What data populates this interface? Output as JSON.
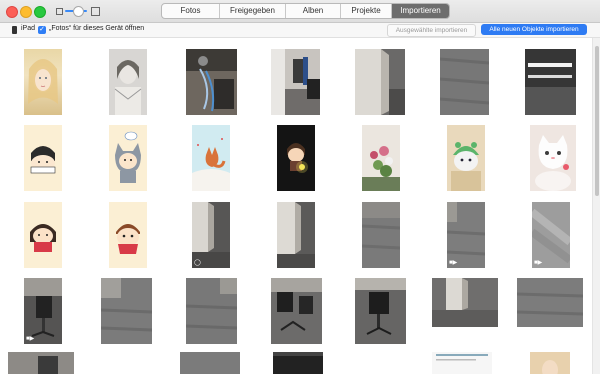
{
  "window": {
    "tabs": [
      {
        "label": "Fotos",
        "active": false
      },
      {
        "label": "Freigegeben",
        "active": false
      },
      {
        "label": "Alben",
        "active": false
      },
      {
        "label": "Projekte",
        "active": false
      },
      {
        "label": "Importieren",
        "active": true
      }
    ]
  },
  "toolbar": {
    "device_name": "iPad",
    "open_photos_checked": true,
    "open_photos_label": "„Fotos“ für dieses Gerät öffnen",
    "import_selected_label": "Ausgewählte importieren",
    "import_all_label": "Alle neuen Objekte importieren"
  },
  "colors": {
    "accent": "#2e7bf3",
    "active_tab": "#6d6d6d"
  },
  "thumbnails": [
    {
      "row": 1,
      "col": 1,
      "kind": "portrait girl blonde",
      "video": false
    },
    {
      "row": 1,
      "col": 2,
      "kind": "vintage portrait",
      "video": false
    },
    {
      "row": 1,
      "col": 3,
      "kind": "office cables",
      "video": false
    },
    {
      "row": 1,
      "col": 4,
      "kind": "office room",
      "video": false
    },
    {
      "row": 1,
      "col": 5,
      "kind": "office corner",
      "video": false
    },
    {
      "row": 1,
      "col": 6,
      "kind": "carpet floor",
      "video": false
    },
    {
      "row": 1,
      "col": 7,
      "kind": "ceiling lights",
      "video": false
    },
    {
      "row": 2,
      "col": 1,
      "kind": "cartoon character",
      "video": false
    },
    {
      "row": 2,
      "col": 2,
      "kind": "cartoon cat hood",
      "video": false
    },
    {
      "row": 2,
      "col": 3,
      "kind": "cartoon fox",
      "video": false
    },
    {
      "row": 2,
      "col": 4,
      "kind": "cartoon boy night",
      "video": false
    },
    {
      "row": 2,
      "col": 5,
      "kind": "flowers",
      "video": false
    },
    {
      "row": 2,
      "col": 6,
      "kind": "green hat kitten",
      "video": false
    },
    {
      "row": 2,
      "col": 7,
      "kind": "white kitten",
      "video": false
    },
    {
      "row": 3,
      "col": 1,
      "kind": "cartoon girl",
      "video": false
    },
    {
      "row": 3,
      "col": 2,
      "kind": "cartoon boy",
      "video": false
    },
    {
      "row": 3,
      "col": 3,
      "kind": "office wall",
      "video": true
    },
    {
      "row": 3,
      "col": 4,
      "kind": "office wall",
      "video": false
    },
    {
      "row": 3,
      "col": 5,
      "kind": "carpet",
      "video": false
    },
    {
      "row": 3,
      "col": 6,
      "kind": "carpet",
      "video": true
    },
    {
      "row": 3,
      "col": 7,
      "kind": "carpet blur",
      "video": true
    },
    {
      "row": 4,
      "col": 1,
      "kind": "office chair",
      "video": true
    },
    {
      "row": 4,
      "col": 2,
      "kind": "carpet",
      "video": false
    },
    {
      "row": 4,
      "col": 3,
      "kind": "carpet",
      "video": false
    },
    {
      "row": 4,
      "col": 4,
      "kind": "chairs",
      "video": false
    },
    {
      "row": 4,
      "col": 5,
      "kind": "chair",
      "video": false
    },
    {
      "row": 4,
      "col": 6,
      "kind": "office wall",
      "video": false
    },
    {
      "row": 4,
      "col": 7,
      "kind": "carpet",
      "video": false
    }
  ]
}
